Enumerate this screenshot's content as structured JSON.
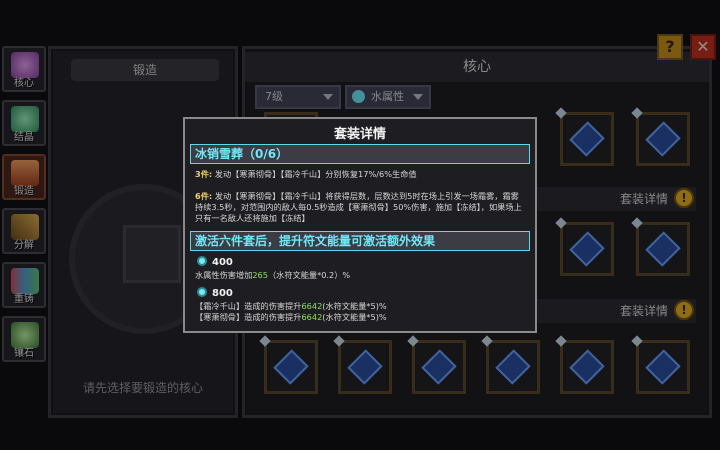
{
  "sidebar": {
    "tabs": [
      {
        "label": "核心",
        "icon": "core-icon",
        "color": "#c070d0"
      },
      {
        "label": "结晶",
        "icon": "crystal-icon",
        "color": "#50c080"
      },
      {
        "label": "锻造",
        "icon": "forge-icon",
        "color": "#e08040",
        "active": true
      },
      {
        "label": "分解",
        "icon": "dismantle-icon",
        "color": "#d0a040"
      },
      {
        "label": "重铸",
        "icon": "recast-icon",
        "color": "#d05060"
      },
      {
        "label": "镶石",
        "icon": "inlay-icon",
        "color": "#60c070"
      }
    ]
  },
  "forge": {
    "title": "锻造",
    "hint": "请先选择要锻造的核心"
  },
  "core": {
    "title": "核心",
    "level_filter": "7级",
    "element_filter": "水属性",
    "set_details_button": "套装详情",
    "bang": "!"
  },
  "top_buttons": {
    "help": "?",
    "close": "✕"
  },
  "modal": {
    "title": "套装详情",
    "set_name": "冰销雪葬（0/6）",
    "effect3_prefix": "3件:",
    "effect3_text": "发动【寒萧彻骨】【霜冷千山】分别恢复17%/6%生命值",
    "effect6_prefix": "6件:",
    "effect6_text": "发动【寒萧彻骨】【霜冷千山】将获得层数，层数达到5时在场上引发一场霜雾，霜雾持续3.5秒，对范围内的敌人每0.5秒造成【寒萧彻骨】50%伤害，施加【冻结】，如果场上只有一名敌人还将施加【冻结】",
    "activate_header": "激活六件套后，提升符文能量可激活额外效果",
    "tier1_value": "400",
    "tier1_line_pre": "水属性伤害增加",
    "tier1_line_num": "265",
    "tier1_line_post": "（水符文能量*0.2）%",
    "tier2_value": "800",
    "tier2_line1_pre": "【霜冷千山】造成的伤害提升",
    "tier2_line1_num": "6642",
    "tier2_line1_post": "(水符文能量*5)%",
    "tier2_line2_pre": "【寒萧彻骨】造成的伤害提升",
    "tier2_line2_num": "6642",
    "tier2_line2_post": "(水符文能量*5)%"
  },
  "colors": {
    "accent_cyan": "#6fe8f8",
    "highlight_green": "#8ae060",
    "prefix_gold": "#f0d070",
    "button_gold": "#e8b020",
    "close_red": "#c03020"
  }
}
